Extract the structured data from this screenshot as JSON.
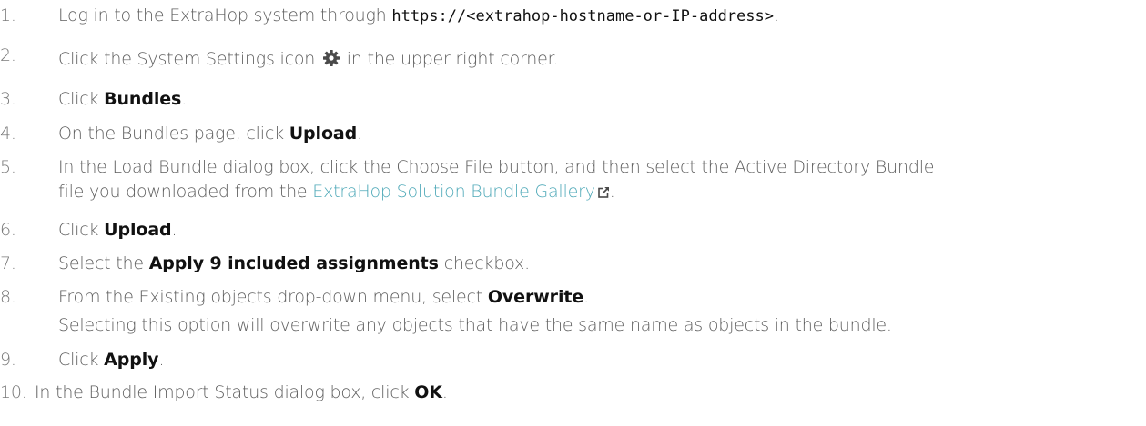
{
  "steps": [
    {
      "number": "1.",
      "pre": "Log in to the ExtraHop system through ",
      "code": "https://<extrahop-hostname-or-IP-address>",
      "post": "."
    },
    {
      "number": "2.",
      "pre": "Click the System Settings icon ",
      "icon": "gear-icon",
      "post": " in the upper right corner."
    },
    {
      "number": "3.",
      "pre": "Click ",
      "bold": "Bundles",
      "post": "."
    },
    {
      "number": "4.",
      "pre": "On the Bundles page, click ",
      "bold": "Upload",
      "post": "."
    },
    {
      "number": "5.",
      "line1": "In the Load Bundle dialog box, click the Choose File button, and then select the Active Directory Bundle",
      "line2_pre": "file you downloaded from the ",
      "link": "ExtraHop Solution Bundle Gallery",
      "link_icon": "external-link-icon",
      "post": "."
    },
    {
      "number": "6.",
      "pre": "Click ",
      "bold": "Upload",
      "post": "."
    },
    {
      "number": "7.",
      "pre": "Select the ",
      "bold": "Apply 9 included assignments",
      "post": " checkbox."
    },
    {
      "number": "8.",
      "pre": "From the Existing objects drop-down menu, select ",
      "bold": "Overwrite",
      "post": ".",
      "note": "Selecting this option will overwrite any objects that have the same name as objects in the bundle."
    },
    {
      "number": "9.",
      "pre": "Click ",
      "bold": "Apply",
      "post": "."
    },
    {
      "number": "10.",
      "pre": "In the Bundle Import Status dialog box, click ",
      "bold": "OK",
      "post": "."
    }
  ],
  "colors": {
    "text": "#5e5e5e",
    "number": "#7a7a7a",
    "bold": "#111111",
    "link": "#4fa9b8",
    "icon": "#4a4a4a"
  }
}
